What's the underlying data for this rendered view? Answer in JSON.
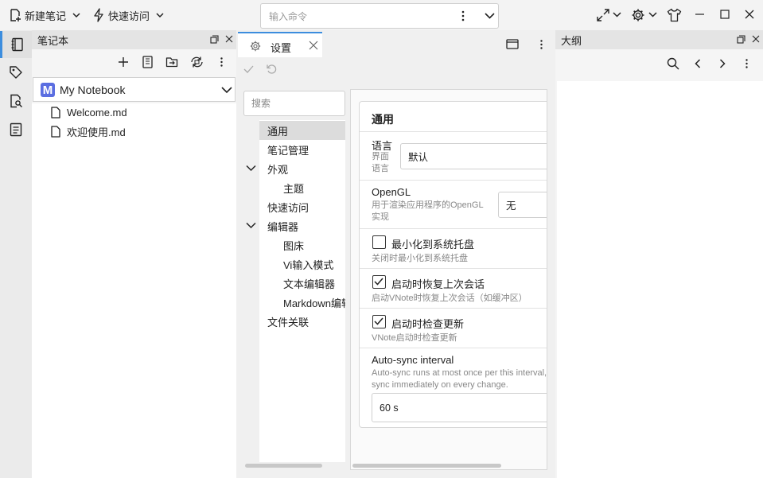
{
  "toolbar": {
    "new_note": "新建笔记",
    "quick_access": "快速访问",
    "command_placeholder": "输入命令"
  },
  "notebook_panel": {
    "title": "笔记本",
    "selected_notebook": "My Notebook",
    "notebook_initial": "M",
    "files": [
      "Welcome.md",
      "欢迎使用.md"
    ]
  },
  "settings_tab": {
    "label": "设置",
    "search_placeholder": "搜索",
    "nav": [
      {
        "label": "通用",
        "selected": true
      },
      {
        "label": "笔记管理"
      },
      {
        "label": "外观",
        "expanded": true
      },
      {
        "label": "主题"
      },
      {
        "label": "快速访问"
      },
      {
        "label": "编辑器",
        "expanded": true
      },
      {
        "label": "图床"
      },
      {
        "label": "Vi输入模式"
      },
      {
        "label": "文本编辑器"
      },
      {
        "label": "Markdown编辑器"
      },
      {
        "label": "文件关联"
      }
    ],
    "section_title": "通用",
    "language": {
      "title": "语言",
      "desc": "界面语言",
      "value": "默认"
    },
    "opengl": {
      "title": "OpenGL",
      "desc": "用于渲染应用程序的OpenGL实现",
      "value": "无"
    },
    "minimize_tray": {
      "title": "最小化到系统托盘",
      "desc": "关闭时最小化到系统托盘",
      "checked": false
    },
    "restore_session": {
      "title": "启动时恢复上次会话",
      "desc": "启动VNote时恢复上次会话（如缓冲区）",
      "checked": true
    },
    "check_updates": {
      "title": "启动时检查更新",
      "desc": "VNote启动时检查更新",
      "checked": true
    },
    "auto_sync": {
      "title": "Auto-sync interval",
      "desc": "Auto-sync runs at most once per this interval, sync immediately on every change.",
      "value": "60 s"
    }
  },
  "outline_panel": {
    "title": "大纲"
  },
  "colors": {
    "accent": "#3c8dde",
    "notebook_badge": "#5b6ee1"
  }
}
